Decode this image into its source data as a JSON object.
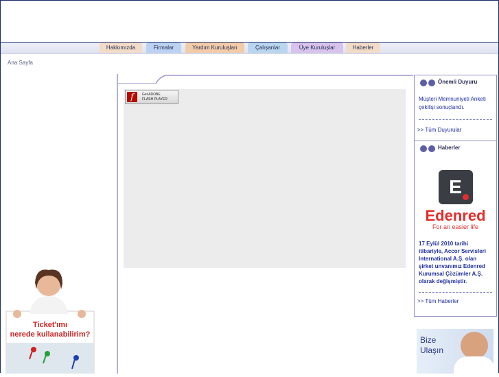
{
  "nav": {
    "tabs": [
      {
        "label": "Hakkımızda",
        "color": "#f2dcc8"
      },
      {
        "label": "Firmalar",
        "color": "#bcd2f2"
      },
      {
        "label": "Yardım Kuruluşları",
        "color": "#f2cca8"
      },
      {
        "label": "Çalışanlar",
        "color": "#b9d6f0"
      },
      {
        "label": "Üye Kuruluşlar",
        "color": "#d7c3ec"
      },
      {
        "label": "Haberler",
        "color": "#f2dcc8"
      }
    ]
  },
  "breadcrumb": "Ana Sayfa",
  "left_ad": {
    "line1": "Ticket'ımı",
    "line2": "nerede kullanabilirim?"
  },
  "flash": {
    "get": "Get ADOBE",
    "player": "FLASH PLAYER",
    "logo": "f"
  },
  "sidebar": {
    "announcement": {
      "title": "Önemli Duyuru",
      "text": "Müşteri Memnuniyeti Anketi çekilişi sonuçlandı.",
      "more": ">> Tüm Duyurular"
    },
    "news": {
      "title": "Haberler",
      "logo_letter": "E",
      "brand": "Edenred",
      "tagline": "For an easier life",
      "text": "17 Eylül 2010 tarihi itibariyle, Accor Servisleri International A.Ş. olan şirket unvanımız Edenred Kurumsal Çözümler A.Ş. olarak değişmiştir.",
      "more": ">> Tüm Haberler"
    },
    "contact": {
      "line1": "Bize",
      "line2": "Ulaşın"
    }
  },
  "colors": {
    "accent": "#1f2ea0",
    "dot": "#5c5ea8",
    "edenred": "#e42d2d"
  }
}
